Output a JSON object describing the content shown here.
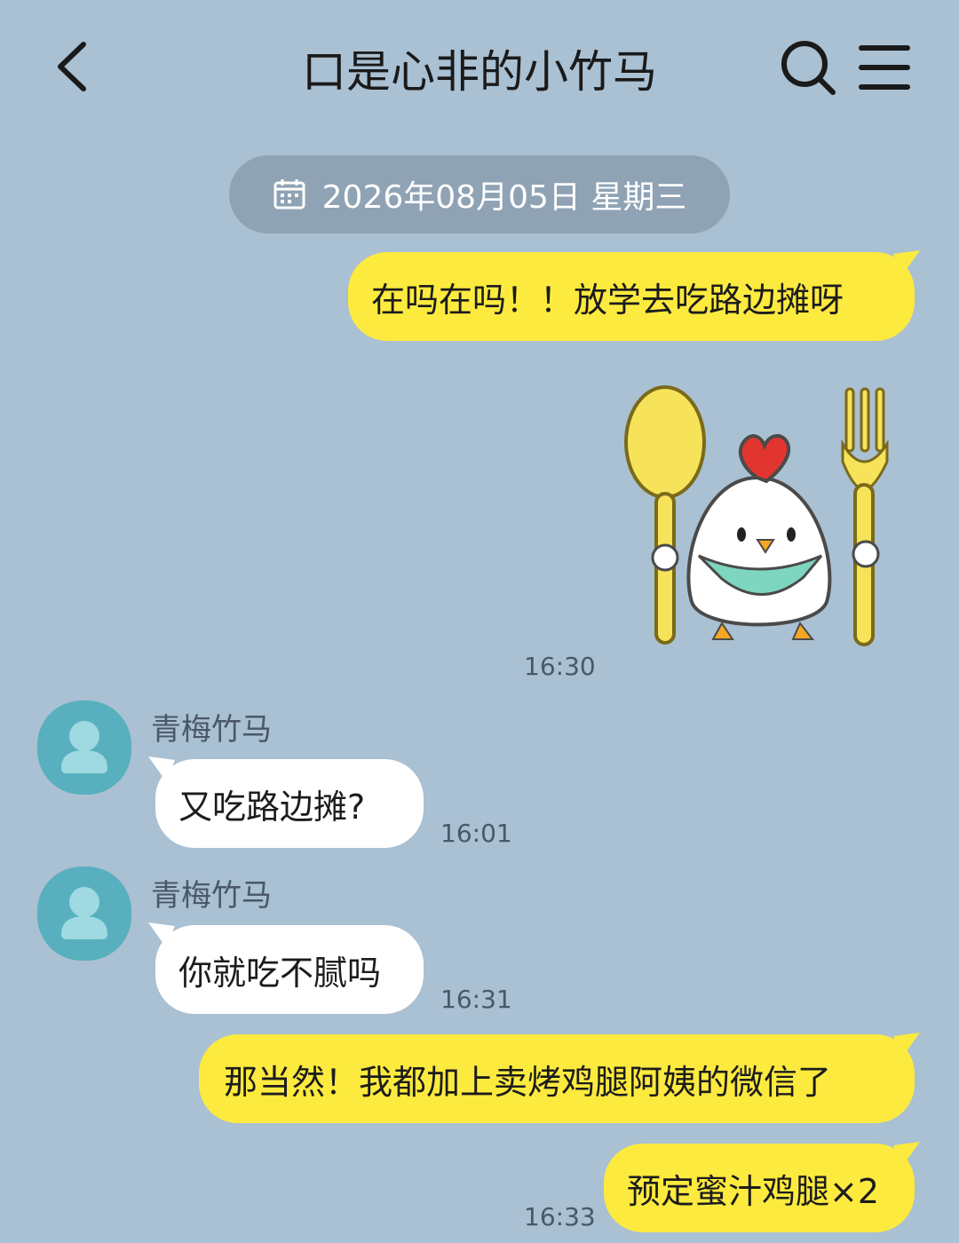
{
  "header": {
    "title": "口是心非的小竹马",
    "back_icon": "chevron-left-icon",
    "search_icon": "search-icon",
    "menu_icon": "menu-icon"
  },
  "date_divider": {
    "icon": "calendar-icon",
    "text": "2026年08月05日 星期三"
  },
  "messages": [
    {
      "direction": "out",
      "type": "text",
      "text": "在吗在吗！！放学去吃路边摊呀"
    },
    {
      "direction": "out",
      "type": "sticker",
      "description": "chicken-with-spoon-and-fork-sticker",
      "time": "16:30"
    },
    {
      "direction": "in",
      "sender": "青梅竹马",
      "type": "text",
      "text": "又吃路边摊?",
      "time": "16:01"
    },
    {
      "direction": "in",
      "sender": "青梅竹马",
      "type": "text",
      "text": "你就吃不腻吗",
      "time": "16:31"
    },
    {
      "direction": "out",
      "type": "text",
      "text": "那当然！我都加上卖烤鸡腿阿姨的微信了"
    },
    {
      "direction": "out",
      "type": "text",
      "text": "预定蜜汁鸡腿×2",
      "time": "16:33"
    }
  ],
  "colors": {
    "background": "#aac0d3",
    "outgoing_bubble": "#fdea3f",
    "incoming_bubble": "#ffffff",
    "avatar": "#58b0be",
    "date_pill": "#8fa3b5"
  }
}
